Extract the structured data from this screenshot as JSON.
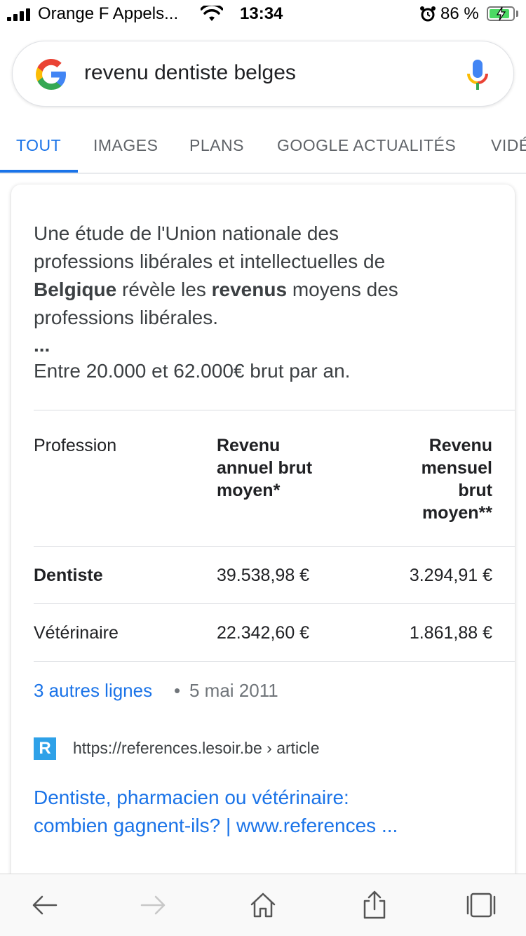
{
  "status_bar": {
    "carrier": "Orange F Appels...",
    "time": "13:34",
    "battery_percent": "86 %",
    "battery_level": 0.86,
    "icons": [
      "signal-icon",
      "wifi-icon",
      "alarm-icon",
      "battery-icon"
    ]
  },
  "search": {
    "query": "revenu dentiste belges",
    "logo": "google-g-logo",
    "mic_icon": "mic-icon"
  },
  "tabs": [
    {
      "label": "TOUT",
      "active": true
    },
    {
      "label": "IMAGES",
      "active": false
    },
    {
      "label": "PLANS",
      "active": false
    },
    {
      "label": "GOOGLE ACTUALITÉS",
      "active": false
    },
    {
      "label": "VIDÉ",
      "active": false
    }
  ],
  "snippet": {
    "line1": "Une étude de l'Union nationale des",
    "line2": "professions libérales et intellectuelles de",
    "bold_belgique": "Belgique",
    "text_revele": " révèle les ",
    "bold_revenus": "revenus",
    "text_moyens": " moyens des",
    "line4": "professions libérales.",
    "ellipsis": "...",
    "range": "Entre 20.000 et 62.000€ brut par an."
  },
  "table": {
    "headers": [
      "Profession",
      "Revenu annuel brut moyen*",
      "Revenu mensuel brut moyen**"
    ],
    "header_lines": {
      "col2": [
        "Revenu",
        "annuel brut",
        "moyen*"
      ],
      "col3": [
        "Revenu",
        "mensuel",
        "brut",
        "moyen**"
      ]
    },
    "rows": [
      {
        "profession": "Dentiste",
        "annual": "39.538,98 €",
        "monthly": "3.294,91 €",
        "bold": true
      },
      {
        "profession": "Vétérinaire",
        "annual": "22.342,60 €",
        "monthly": "1.861,88 €",
        "bold": false
      }
    ]
  },
  "more": {
    "link": "3 autres lignes",
    "separator": "•",
    "date": "5 mai 2011"
  },
  "source": {
    "favicon_letter": "R",
    "url": "https://references.lesoir.be › article",
    "title_line1": "Dentiste, pharmacien ou vétérinaire:",
    "title_line2": "combien gagnent-ils? | www.references ..."
  },
  "toolbar": {
    "icons": [
      "back-icon",
      "forward-icon",
      "home-icon",
      "share-icon",
      "tabs-icon"
    ]
  },
  "colors": {
    "accent": "#1a73e8",
    "text": "#202124",
    "muted": "#70757a"
  }
}
